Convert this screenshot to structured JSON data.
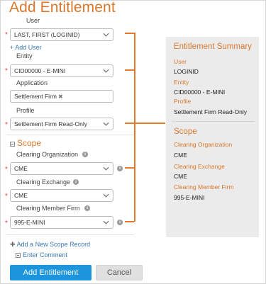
{
  "page_title": "Add Entitlement",
  "form": {
    "user": {
      "label": "User",
      "value": "LAST, FIRST (LOGINID)"
    },
    "add_user_link": "Add User",
    "entity": {
      "label": "Entity",
      "value": "CID00000 - E-MINI"
    },
    "application": {
      "label": "Application",
      "value": "Settlement Firm"
    },
    "profile": {
      "label": "Profile",
      "value": "Settlement Firm Read-Only"
    },
    "scope_title": "Scope",
    "clearing_org": {
      "label": "Clearing Organization",
      "value": "CME"
    },
    "clearing_exchange": {
      "label": "Clearing Exchange",
      "value": "CME"
    },
    "clearing_member_firm": {
      "label": "Clearing Member Firm",
      "value": "995-E-MINI"
    },
    "add_scope_link": "Add a New Scope Record",
    "enter_comment_link": "Enter Comment"
  },
  "summary": {
    "title": "Entitlement Summary",
    "user_label": "User",
    "user_value": "LOGINID",
    "entity_label": "Entity",
    "entity_value": "CID00000 - E-MINI",
    "profile_label": "Profile",
    "profile_value": "Settlement Firm Read-Only",
    "scope_title": "Scope",
    "clearing_org_label": "Clearing Organization",
    "clearing_org_value": "CME",
    "clearing_exchange_label": "Clearing Exchange",
    "clearing_exchange_value": "CME",
    "clearing_member_label": "Clearing Member Firm",
    "clearing_member_value": "995-E-MINI"
  },
  "buttons": {
    "add_entitlement": "Add Entitlement",
    "cancel": "Cancel"
  },
  "icons": {
    "required": "asterisk",
    "dropdown": "chevron-down-icon",
    "info": "info-icon",
    "remove_chip": "close-icon",
    "collapse": "minus-square-icon",
    "expand": "plus-square-icon",
    "add": "plus-icon"
  },
  "colors": {
    "accent": "#d9782d",
    "link": "#3a78b5",
    "primary_button": "#1c95dd",
    "required": "#e0403a",
    "connector": "#e6782c"
  }
}
